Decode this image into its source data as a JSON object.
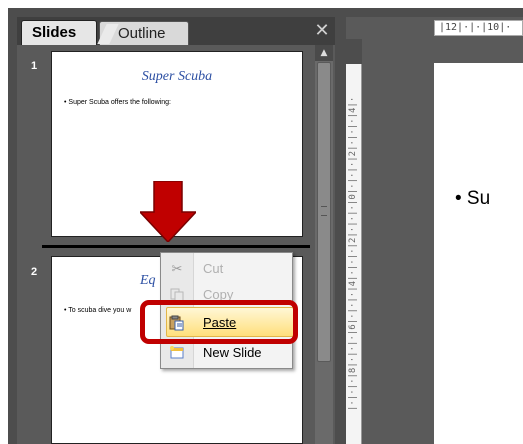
{
  "panel": {
    "tabs": [
      {
        "label": "Slides",
        "active": true
      },
      {
        "label": "Outline",
        "active": false
      }
    ],
    "close_icon": "close-x-icon"
  },
  "slides": [
    {
      "number": "1",
      "title": "Super Scuba",
      "bullet": "• Super Scuba offers the following:"
    },
    {
      "number": "2",
      "title": "Eq",
      "bullet": "• To scuba dive you w"
    }
  ],
  "context_menu": {
    "items": [
      {
        "label": "Cut",
        "icon": "scissors-icon",
        "enabled": false
      },
      {
        "label": "Copy",
        "icon": "copy-icon",
        "enabled": false
      },
      {
        "label": "Paste",
        "icon": "paste-icon",
        "enabled": true,
        "highlighted": true
      },
      {
        "label": "New Slide",
        "icon": "new-slide-icon",
        "enabled": true
      }
    ]
  },
  "ruler": {
    "top_text": "|12|·|·|10|·",
    "left_text": "|·|·|·|8|·|·|·|6|·|·|·|4|·|·|·|2|·|·|·|0|·|·|·|2|·|·|·|4|·"
  },
  "editor": {
    "bullet_text": "• Su"
  },
  "colors": {
    "highlight_red": "#c00000",
    "arrow_red": "#c00000",
    "title_blue": "#2c4fa3"
  }
}
